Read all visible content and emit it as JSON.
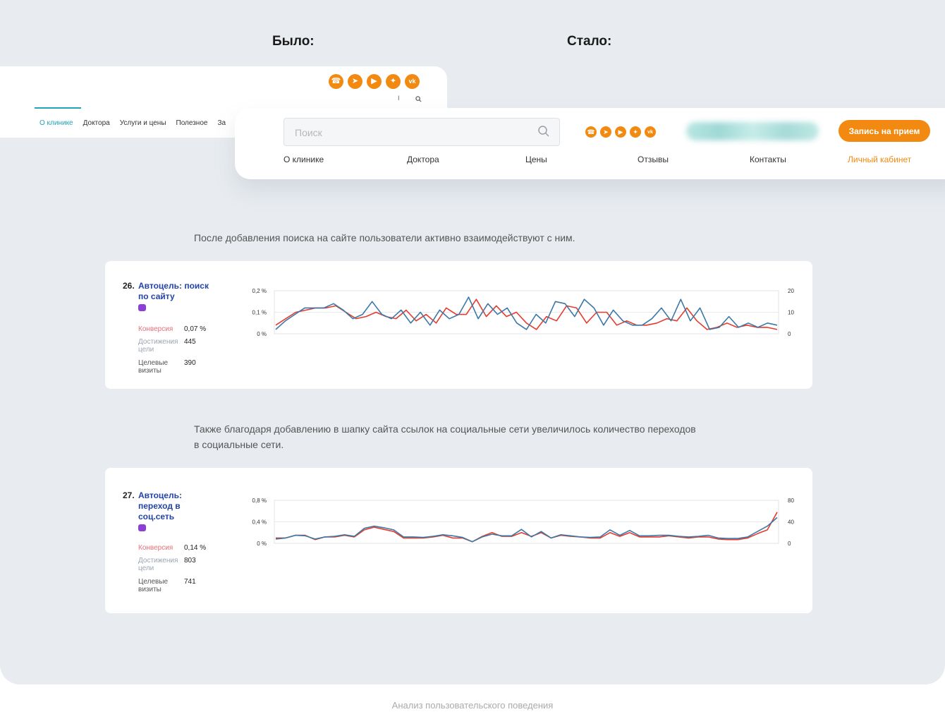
{
  "labels": {
    "before": "Было:",
    "after": "Стало:"
  },
  "old_header": {
    "nav": [
      "О клинике",
      "Доктора",
      "Услуги и цены",
      "Полезное",
      "За"
    ],
    "mini_text": "I"
  },
  "new_header": {
    "search_placeholder": "Поиск",
    "book_button": "Запись на прием",
    "nav": [
      "О клинике",
      "Доктора",
      "Цены",
      "Отзывы",
      "Контакты"
    ],
    "cabinet_link": "Личный кабинет"
  },
  "social_icons": [
    "whatsapp-icon",
    "telegram-icon",
    "youtube-icon",
    "zen-icon",
    "vk-icon"
  ],
  "colors": {
    "accent": "#f28a12",
    "teal": "#20a4b8",
    "series_red": "#e63b2e",
    "series_blue": "#3c78a6"
  },
  "text1": "После добавления поиска на сайте пользователи активно взаимодействуют с ним.",
  "text2_line1": "Также благодаря добавлению в шапку сайта ссылок на социальные сети увеличилось количество переходов",
  "text2_line2": "в социальные сети.",
  "caption": "Анализ пользовательского поведения",
  "goals": [
    {
      "number": "26.",
      "title": "Автоцель: поиск по сайту",
      "metrics": {
        "conversion_label": "Конверсия",
        "conversion": "0,07 %",
        "achievements_label": "Достижения цели",
        "achievements": "445",
        "visits_label": "Целевые визиты",
        "visits": "390"
      }
    },
    {
      "number": "27.",
      "title": "Автоцель: переход в соц.сеть",
      "metrics": {
        "conversion_label": "Конверсия",
        "conversion": "0,14 %",
        "achievements_label": "Достижения цели",
        "achievements": "803",
        "visits_label": "Целевые визиты",
        "visits": "741"
      }
    }
  ],
  "chart_data": [
    {
      "type": "line",
      "y_ticks_left": [
        "0,2 %",
        "0,1 %",
        "0 %"
      ],
      "y_ticks_right": [
        "20",
        "10",
        "0"
      ],
      "ylim_left": [
        0,
        0.2
      ],
      "ylim_right": [
        0,
        20
      ],
      "grid": true,
      "series": [
        {
          "axis": "left",
          "color": "#e63b2e",
          "values": [
            0.04,
            0.07,
            0.1,
            0.11,
            0.12,
            0.12,
            0.13,
            0.1,
            0.07,
            0.08,
            0.1,
            0.08,
            0.07,
            0.11,
            0.06,
            0.09,
            0.05,
            0.12,
            0.09,
            0.09,
            0.16,
            0.08,
            0.13,
            0.08,
            0.1,
            0.05,
            0.02,
            0.08,
            0.06,
            0.13,
            0.12,
            0.05,
            0.1,
            0.1,
            0.04,
            0.06,
            0.04,
            0.04,
            0.05,
            0.07,
            0.06,
            0.12,
            0.06,
            0.02,
            0.03,
            0.05,
            0.03,
            0.04,
            0.03,
            0.03,
            0.02
          ]
        },
        {
          "axis": "right",
          "color": "#3c78a6",
          "values": [
            2,
            6,
            9,
            12,
            12,
            12,
            14,
            11,
            7,
            9,
            15,
            9,
            7,
            11,
            5,
            10,
            4,
            11,
            7,
            9,
            17,
            7,
            14,
            9,
            12,
            5,
            2,
            9,
            5,
            15,
            14,
            8,
            16,
            12,
            4,
            11,
            6,
            4,
            4,
            7,
            12,
            6,
            16,
            6,
            12,
            2,
            3,
            8,
            3,
            5,
            3,
            5,
            4
          ]
        }
      ]
    },
    {
      "type": "line",
      "y_ticks_left": [
        "0,8 %",
        "0,4 %",
        "0 %"
      ],
      "y_ticks_right": [
        "80",
        "40",
        "0"
      ],
      "ylim_left": [
        0,
        0.8
      ],
      "ylim_right": [
        0,
        80
      ],
      "grid": true,
      "series": [
        {
          "axis": "left",
          "color": "#e63b2e",
          "values": [
            0.1,
            0.1,
            0.15,
            0.15,
            0.07,
            0.12,
            0.12,
            0.15,
            0.12,
            0.25,
            0.3,
            0.26,
            0.22,
            0.1,
            0.1,
            0.1,
            0.12,
            0.15,
            0.1,
            0.1,
            0.03,
            0.13,
            0.2,
            0.13,
            0.13,
            0.2,
            0.13,
            0.2,
            0.1,
            0.15,
            0.13,
            0.12,
            0.1,
            0.1,
            0.2,
            0.13,
            0.2,
            0.12,
            0.12,
            0.12,
            0.14,
            0.12,
            0.1,
            0.12,
            0.12,
            0.08,
            0.07,
            0.07,
            0.1,
            0.18,
            0.25,
            0.58
          ]
        },
        {
          "axis": "right",
          "color": "#3c78a6",
          "values": [
            8,
            10,
            15,
            14,
            8,
            12,
            13,
            16,
            13,
            28,
            32,
            29,
            25,
            12,
            12,
            11,
            13,
            16,
            14,
            11,
            3,
            12,
            17,
            14,
            14,
            26,
            12,
            22,
            10,
            16,
            14,
            12,
            11,
            12,
            25,
            15,
            24,
            14,
            14,
            15,
            15,
            13,
            12,
            13,
            15,
            10,
            9,
            9,
            12,
            22,
            32,
            48
          ]
        }
      ]
    }
  ]
}
